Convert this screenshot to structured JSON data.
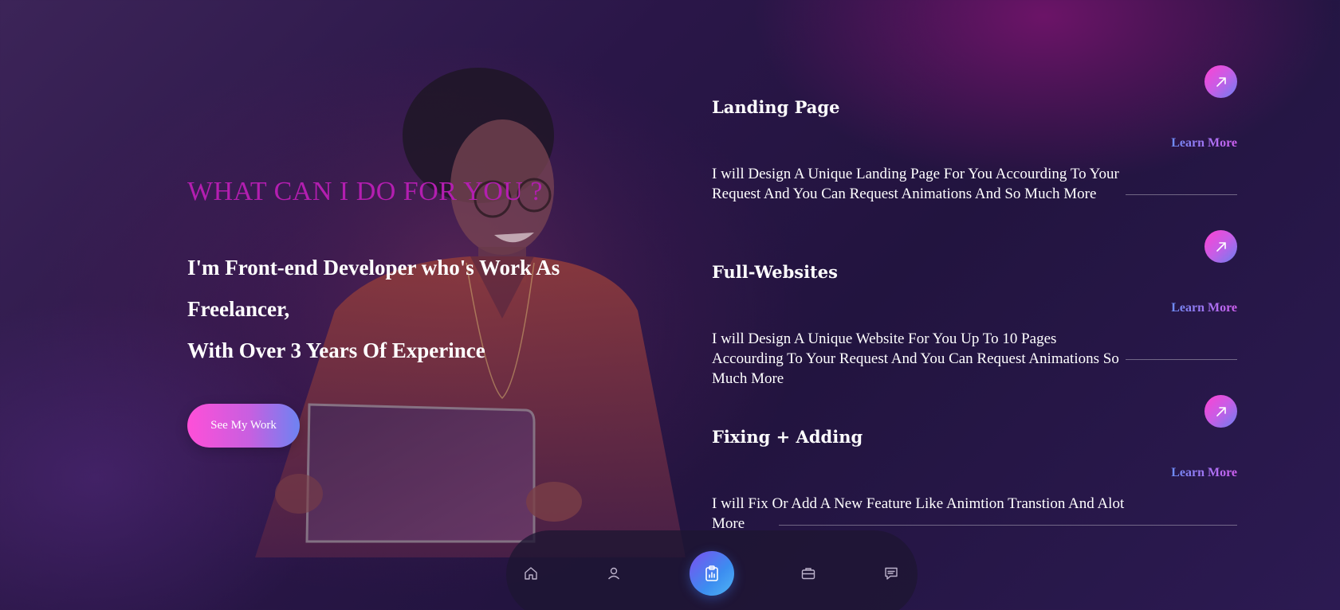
{
  "colors": {
    "accent_pink": "#ff41d2",
    "accent_purple": "#b31eb0",
    "accent_blue": "#6a7ff0",
    "background": "#2a1648"
  },
  "hero": {
    "section_heading": "WHAT CAN I DO FOR YOU ?",
    "intro_line_1": "I'm Front-end Developer who's Work As",
    "intro_line_2": "Freelancer,",
    "intro_line_3": "With Over 3 Years Of Experince",
    "cta_label": "See My Work"
  },
  "services": [
    {
      "title": "Landing Page",
      "learn_more": "Learn More",
      "description": "I will Design A Unique Landing Page For You Accourding To Your Request And You Can Request Animations And So Much More",
      "icon": "arrow-up-right-icon"
    },
    {
      "title": "Full-Websites",
      "learn_more": "Learn More",
      "description": "I will Design A Unique Website For You Up To 10 Pages Accourding To Your Request And You Can Request Animations So Much More",
      "icon": "arrow-up-right-icon"
    },
    {
      "title": "Fixing + Adding",
      "learn_more": "Learn More",
      "description": "I will Fix Or Add A New Feature Like Animtion Transtion And Alot More",
      "icon": "arrow-up-right-icon"
    }
  ],
  "bottom_nav": {
    "items": [
      {
        "icon": "home-icon",
        "active": false
      },
      {
        "icon": "user-icon",
        "active": false
      },
      {
        "icon": "clipboard-chart-icon",
        "active": true
      },
      {
        "icon": "briefcase-icon",
        "active": false
      },
      {
        "icon": "message-icon",
        "active": false
      }
    ]
  }
}
